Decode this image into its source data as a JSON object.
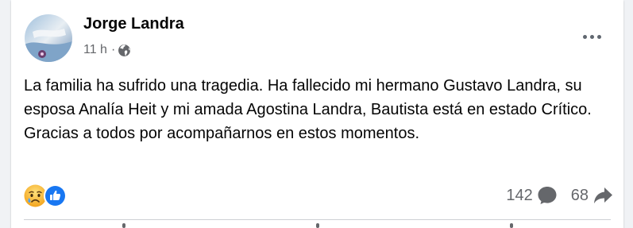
{
  "post": {
    "author": "Jorge Landra",
    "time": "11 h",
    "separator": "·",
    "audience_icon": "globe-icon",
    "more_icon": "ellipsis-icon",
    "text_lines": [
      "La familia ha sufrido una tragedia. Ha fallecido mi hermano Gustavo Landra, su esposa Analía Heit y mi amada Agostina Landra, Bautista está en estado Crítico.",
      "Gracias a todos por acompañarnos en estos momentos."
    ],
    "reactions": [
      "sad-reaction-icon",
      "like-reaction-icon"
    ],
    "comments_count": "142",
    "shares_count": "68"
  },
  "colors": {
    "text": "#050505",
    "secondary_text": "#65676b",
    "like_blue": "#1877f2",
    "sad_yellow": "#f7b125",
    "background": "#f0f2f5"
  }
}
